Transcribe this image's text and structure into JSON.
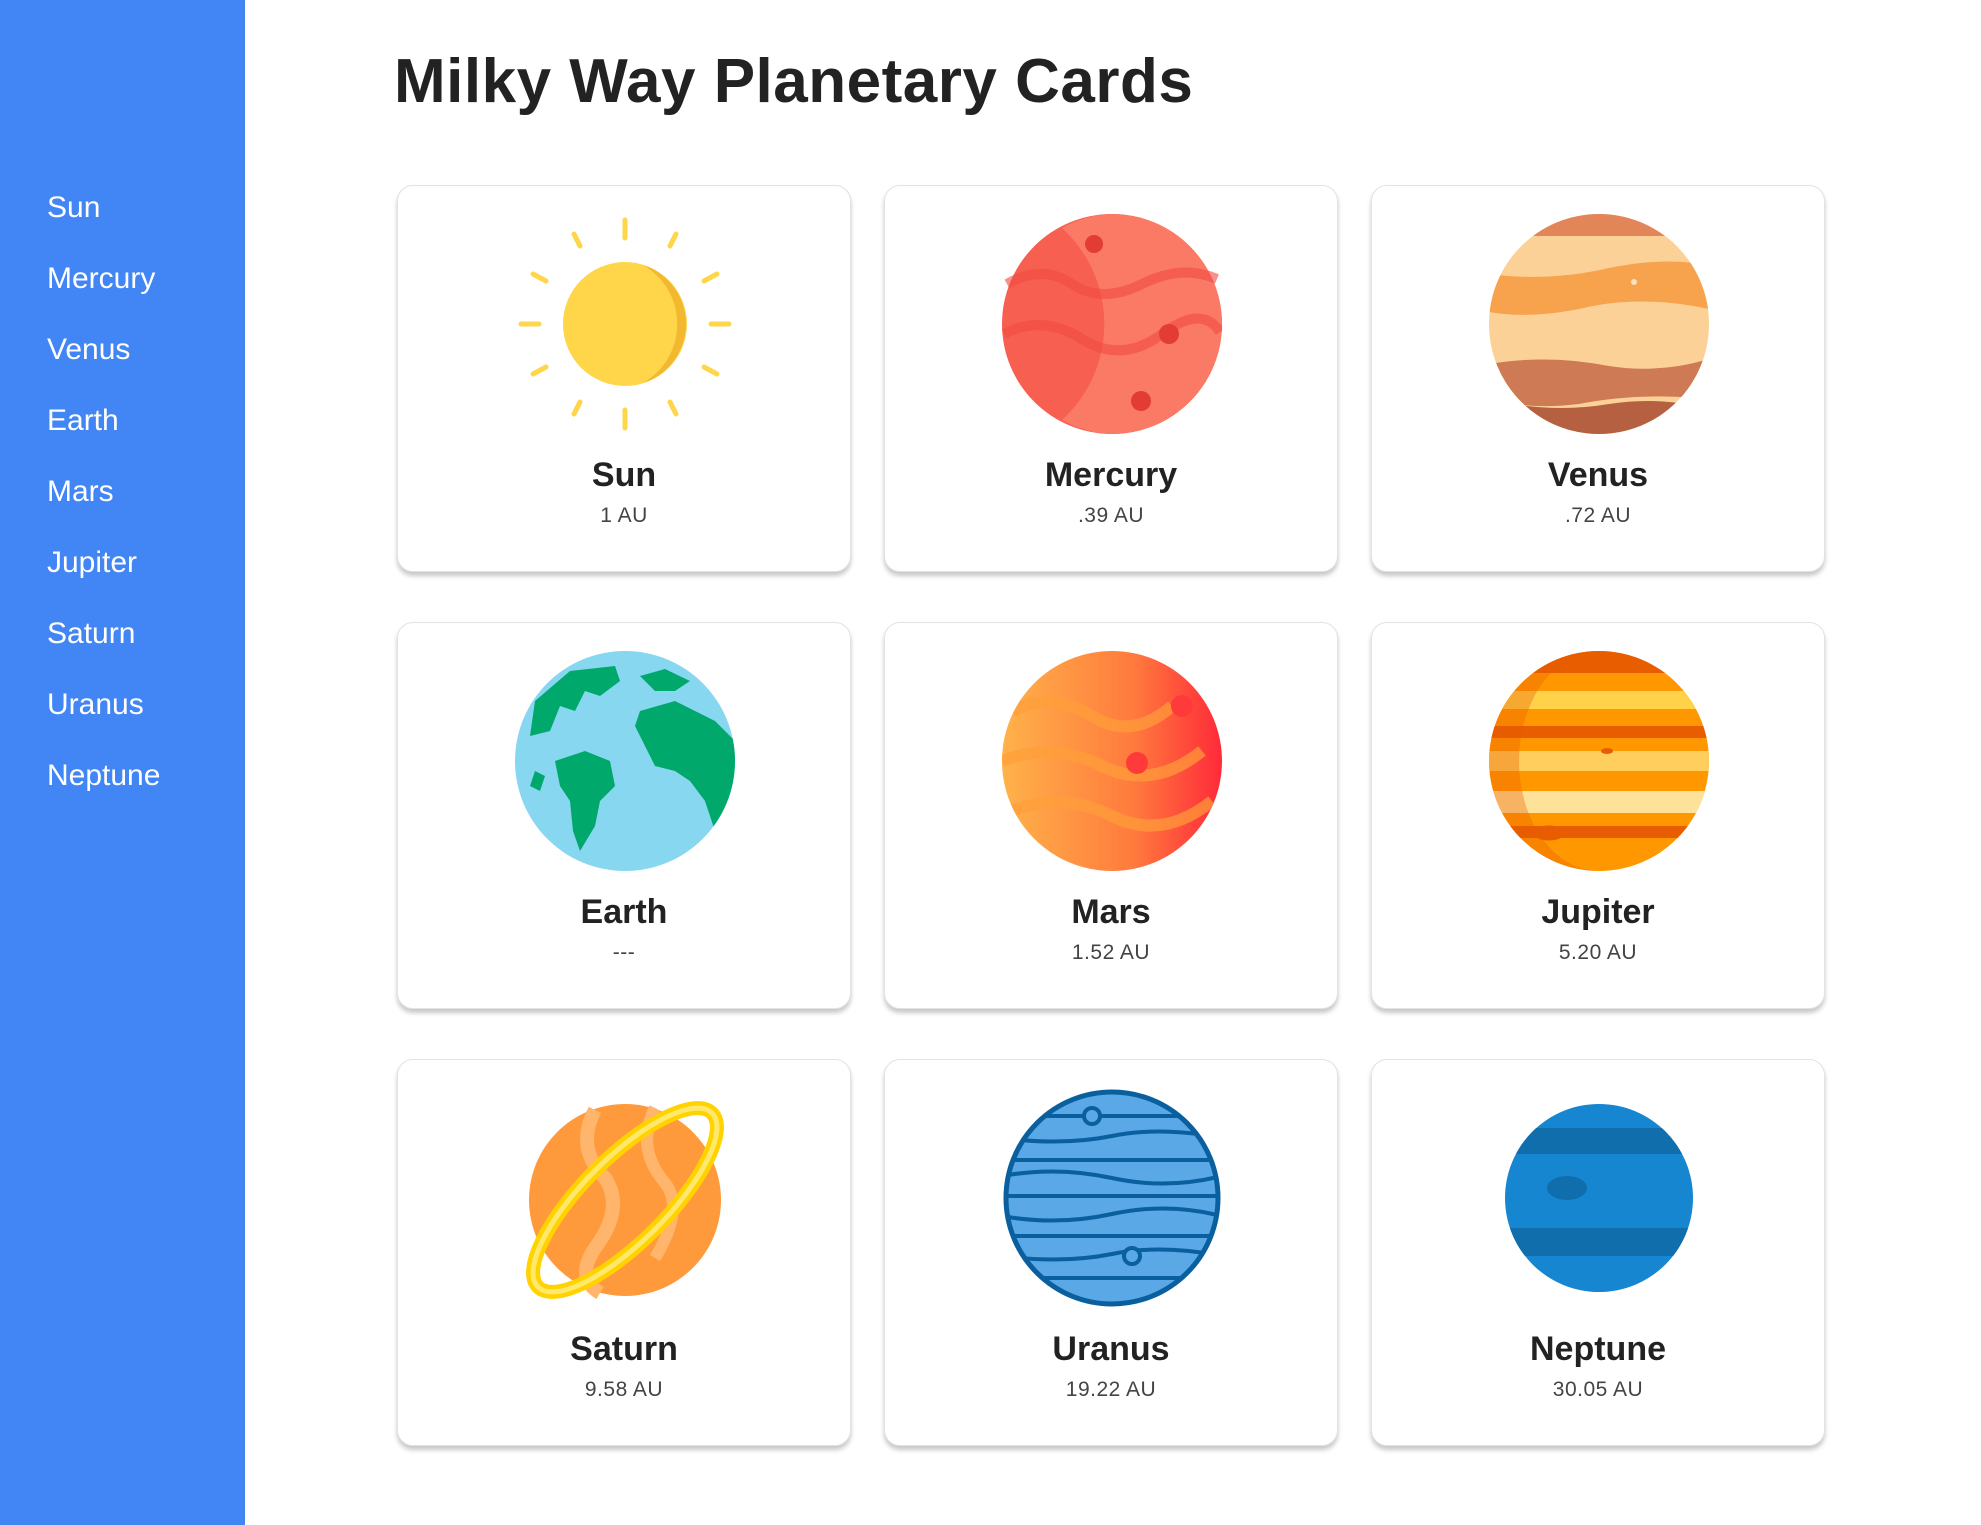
{
  "page": {
    "title": "Milky Way Planetary Cards"
  },
  "sidebar": {
    "items": [
      {
        "label": "Sun"
      },
      {
        "label": "Mercury"
      },
      {
        "label": "Venus"
      },
      {
        "label": "Earth"
      },
      {
        "label": "Mars"
      },
      {
        "label": "Jupiter"
      },
      {
        "label": "Saturn"
      },
      {
        "label": "Uranus"
      },
      {
        "label": "Neptune"
      }
    ]
  },
  "cards": [
    {
      "name": "Sun",
      "distance": "1 AU",
      "icon": "sun-icon"
    },
    {
      "name": "Mercury",
      "distance": ".39 AU",
      "icon": "mercury-icon"
    },
    {
      "name": "Venus",
      "distance": ".72 AU",
      "icon": "venus-icon"
    },
    {
      "name": "Earth",
      "distance": "---",
      "icon": "earth-icon"
    },
    {
      "name": "Mars",
      "distance": "1.52 AU",
      "icon": "mars-icon"
    },
    {
      "name": "Jupiter",
      "distance": "5.20 AU",
      "icon": "jupiter-icon"
    },
    {
      "name": "Saturn",
      "distance": "9.58 AU",
      "icon": "saturn-icon"
    },
    {
      "name": "Uranus",
      "distance": "19.22 AU",
      "icon": "uranus-icon"
    },
    {
      "name": "Neptune",
      "distance": "30.05 AU",
      "icon": "neptune-icon"
    }
  ],
  "colors": {
    "sidebar": "#4285f4",
    "sun": "#ffd54a",
    "mercury": "#f75f50",
    "venus": "#f4a261",
    "earth_ocean": "#87d7f0",
    "earth_land": "#00a86b",
    "mars": "#ff7a3d",
    "jupiter": "#ff9800",
    "saturn": "#ff9a3c",
    "saturn_ring": "#ffd200",
    "uranus": "#5aa8e6",
    "neptune": "#1686d0"
  }
}
